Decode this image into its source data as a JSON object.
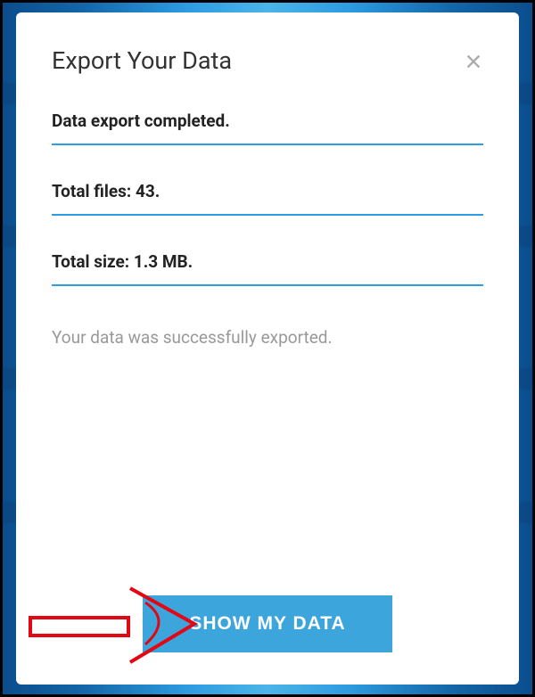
{
  "dialog": {
    "title": "Export Your Data",
    "status": "Data export completed.",
    "total_files": "Total files: 43.",
    "total_size": "Total size: 1.3 MB.",
    "success_message": "Your data was successfully exported.",
    "primary_button": "SHOW MY DATA"
  },
  "colors": {
    "accent": "#2d9ce0",
    "button": "#3ba5dc",
    "annotation": "#e30613"
  }
}
